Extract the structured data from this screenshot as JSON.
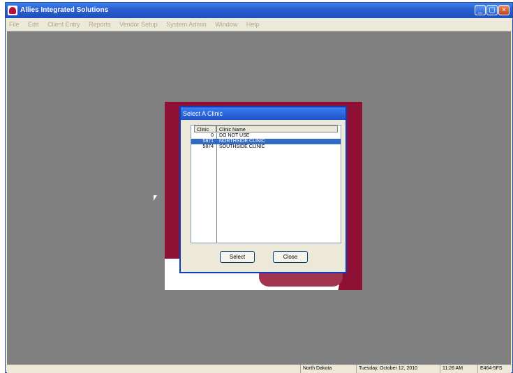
{
  "window": {
    "title": "Allies Integrated Solutions"
  },
  "menu": [
    "File",
    "Edit",
    "Client Entry",
    "Reports",
    "Vendor Setup",
    "System Admin",
    "Window",
    "Help"
  ],
  "dialog": {
    "title": "Select A Clinic",
    "columns": [
      "Clinic",
      "Clinic Name"
    ],
    "rows": [
      {
        "id": "0",
        "name": "DO NOT USE"
      },
      {
        "id": "5871",
        "name": "NORTHSIDE CLINIC"
      },
      {
        "id": "5874",
        "name": "SOUTHSIDE CLINIC"
      }
    ],
    "selected_index": 1,
    "select_label": "Select",
    "close_label": "Close"
  },
  "status": {
    "state": "North Dakota",
    "date": "Tuesday, October 12, 2010",
    "time": "11:26 AM",
    "code": "E464-5FS"
  },
  "colors": {
    "desktop": "#808080",
    "selection": "#316ac5",
    "splash_red": "#8e1034"
  }
}
